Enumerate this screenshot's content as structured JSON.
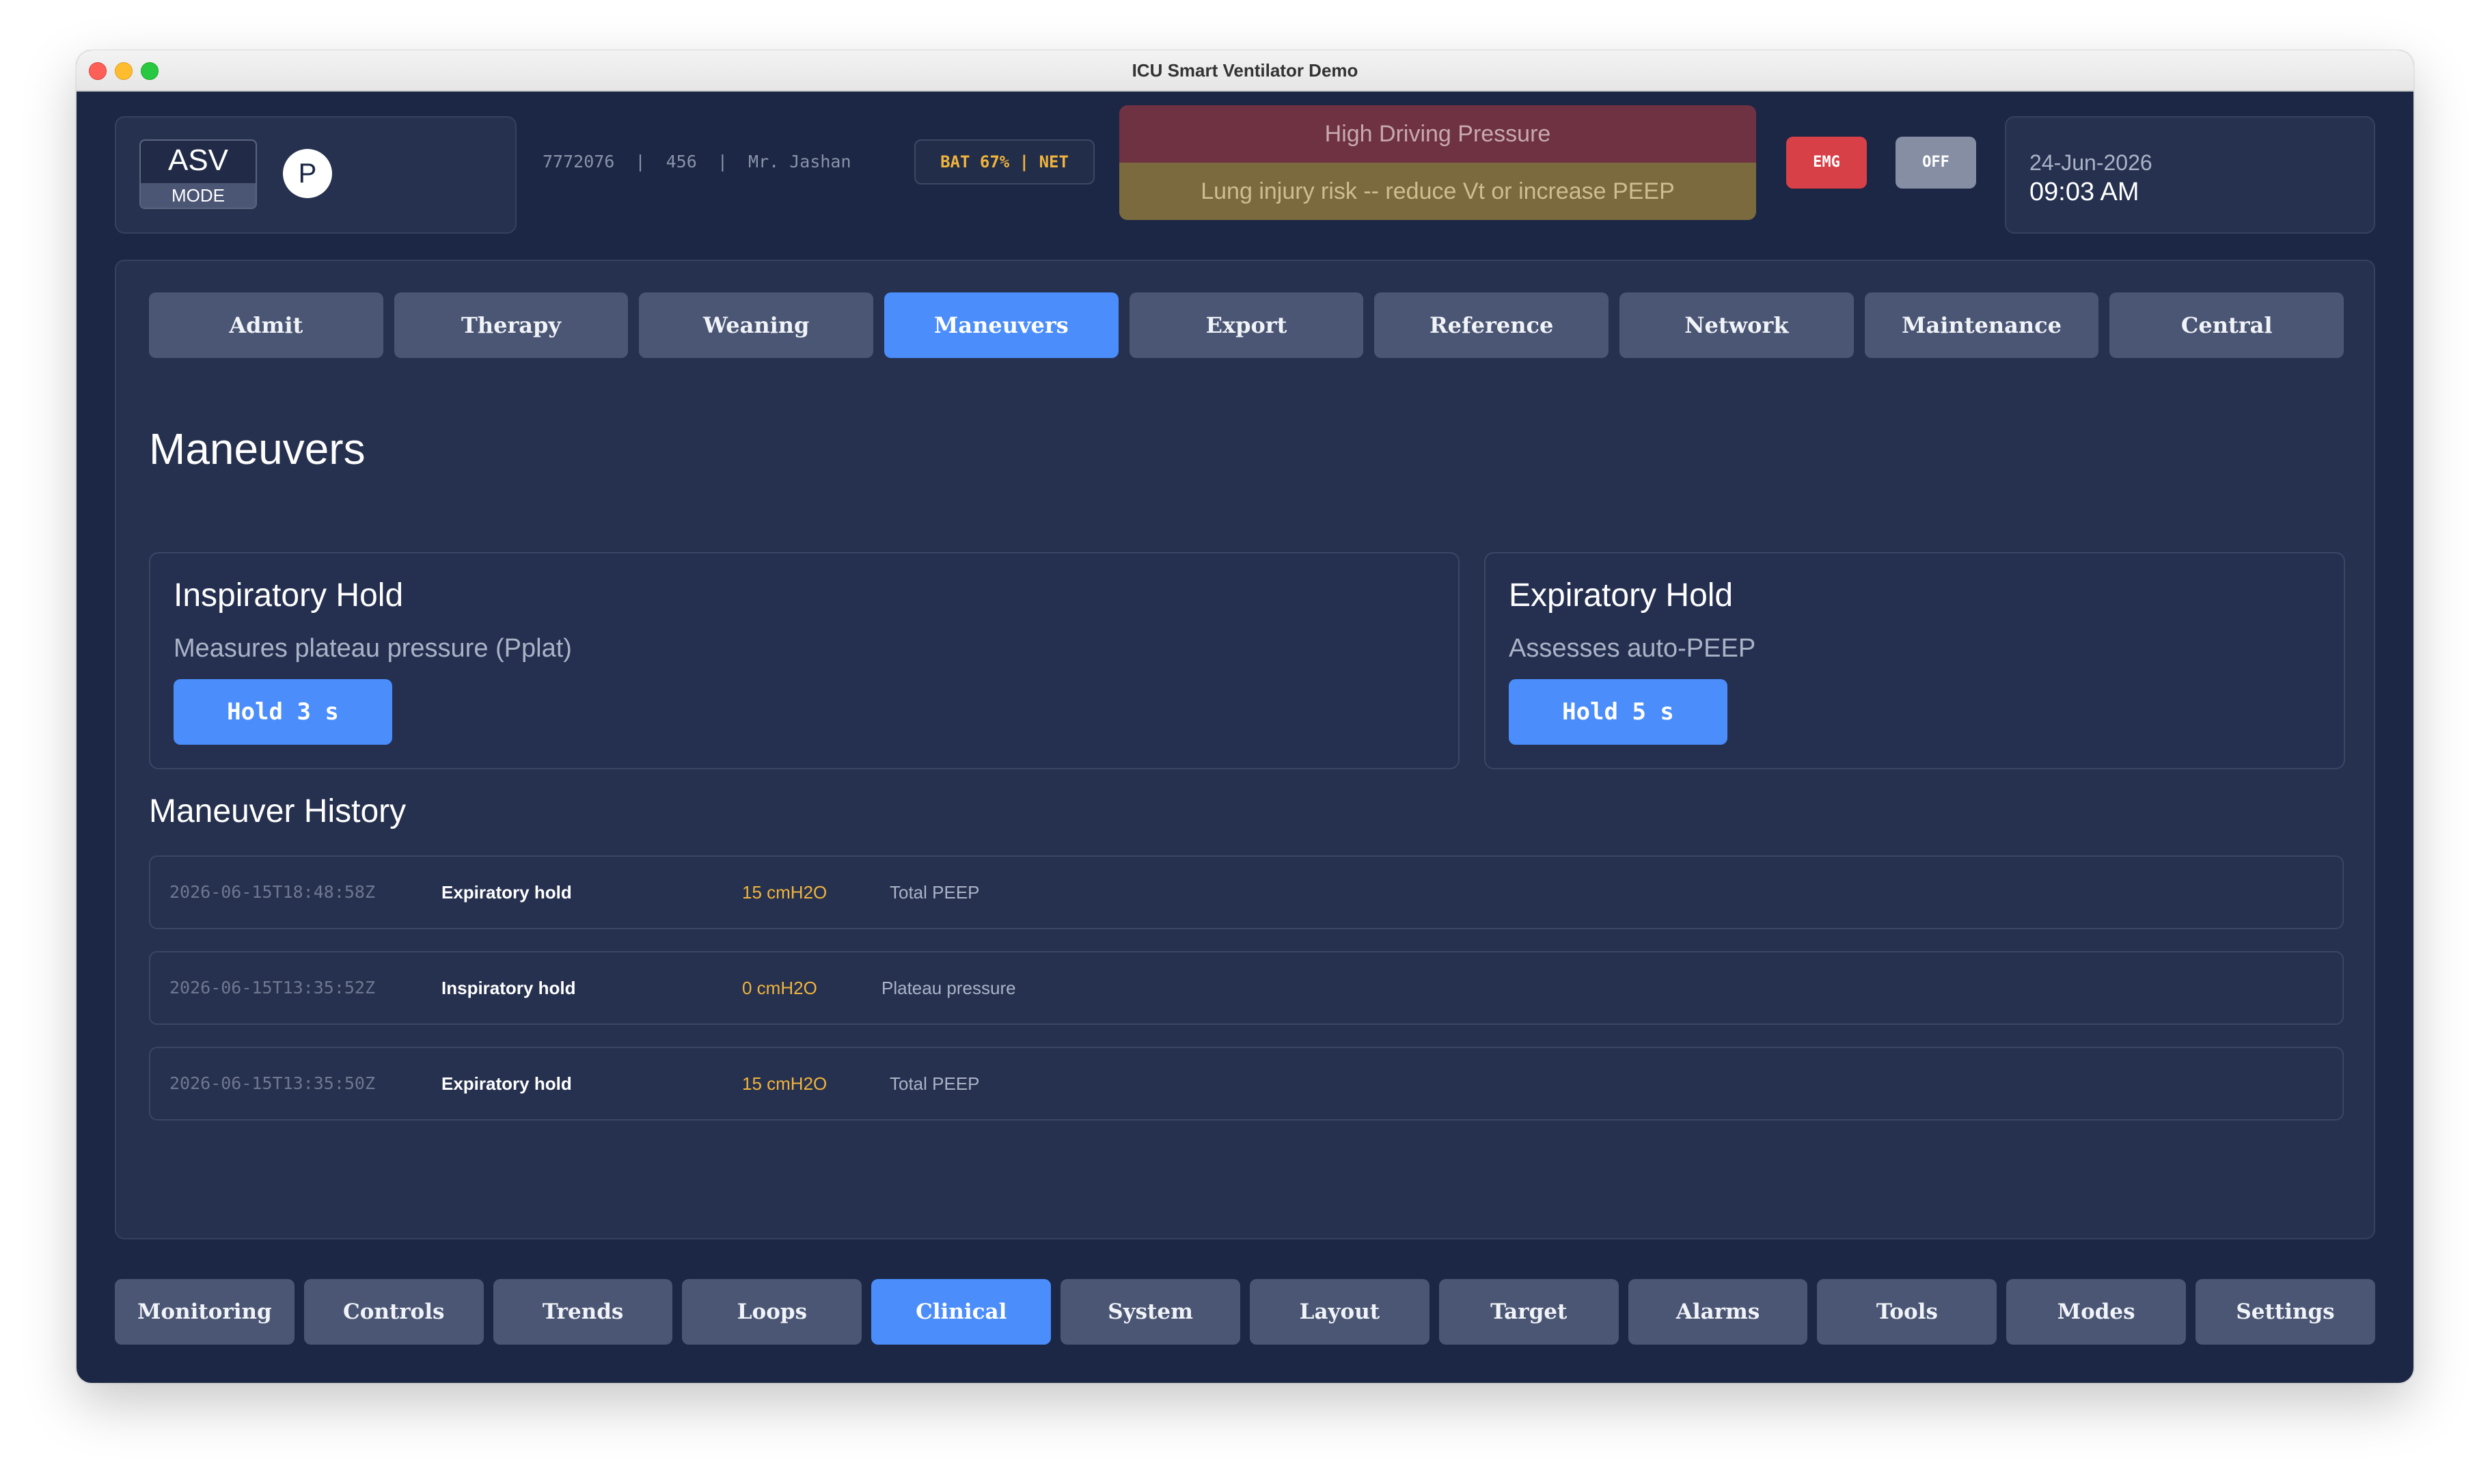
{
  "window": {
    "title": "ICU Smart Ventilator Demo"
  },
  "header": {
    "mode": "ASV",
    "mode_sub": "MODE",
    "mode_circle": "P",
    "patient_info": "7772076  |  456  |  Mr. Jashan",
    "battery_status": "BAT 67% | NET",
    "alarm_title": "High Driving Pressure",
    "alarm_message": "Lung injury risk -- reduce Vt or increase PEEP",
    "emg_label": "EMG",
    "off_label": "OFF",
    "date": "24-Jun-2026",
    "time": "09:03 AM"
  },
  "tabs": [
    "Admit",
    "Therapy",
    "Weaning",
    "Maneuvers",
    "Export",
    "Reference",
    "Network",
    "Maintenance",
    "Central"
  ],
  "active_tab": "Maneuvers",
  "page": {
    "title": "Maneuvers",
    "inspiratory": {
      "title": "Inspiratory Hold",
      "description": "Measures plateau pressure (Pplat)",
      "button": "Hold 3 s"
    },
    "expiratory": {
      "title": "Expiratory Hold",
      "description": "Assesses auto-PEEP",
      "button": "Hold 5 s"
    },
    "history_title": "Maneuver History",
    "history": [
      {
        "timestamp": "2026-06-15T18:48:58Z",
        "type": "Expiratory hold",
        "value": "15 cmH2O",
        "description": "Total PEEP"
      },
      {
        "timestamp": "2026-06-15T13:35:52Z",
        "type": "Inspiratory hold",
        "value": "0 cmH2O",
        "description": "Plateau pressure"
      },
      {
        "timestamp": "2026-06-15T13:35:50Z",
        "type": "Expiratory hold",
        "value": "15 cmH2O",
        "description": "Total PEEP"
      }
    ]
  },
  "bottom_nav": [
    "Monitoring",
    "Controls",
    "Trends",
    "Loops",
    "Clinical",
    "System",
    "Layout",
    "Target",
    "Alarms",
    "Tools",
    "Modes",
    "Settings"
  ],
  "active_bottom_nav": "Clinical",
  "colors": {
    "background": "#1b2744",
    "panel": "#26314f",
    "accent": "#4a8dfb",
    "button": "#4b5674",
    "alarm_red": "#6e3243",
    "alarm_yellow": "#7a6a3e",
    "value_amber": "#f0b43c",
    "emg_red": "#d84048"
  }
}
